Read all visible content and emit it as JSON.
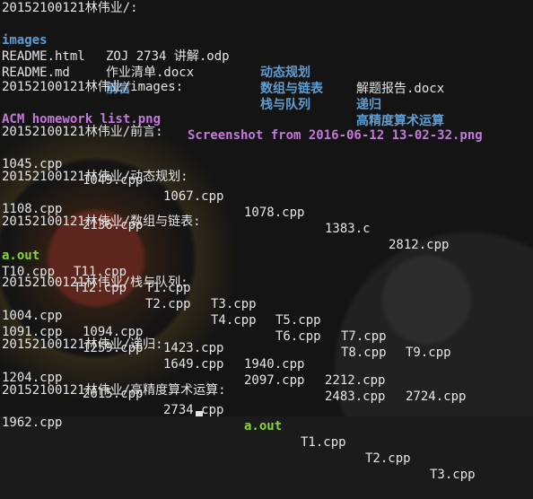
{
  "colors": {
    "background": "#1b1b1b",
    "text": "#e6e6e6",
    "directory": "#5f9ed5",
    "executable": "#87d72f",
    "image_file": "#c678dd"
  },
  "root_header": "20152100121林伟业/:",
  "root_listing": [
    {
      "name": "images",
      "type": "dir"
    },
    {
      "name": "ZOJ 2734 讲解.odp",
      "type": "file"
    },
    {
      "name": "动态规划",
      "type": "dir"
    },
    {
      "name": "解题报告.docx",
      "type": "file"
    },
    {
      "name": "README.html",
      "type": "file"
    },
    {
      "name": "作业清单.docx",
      "type": "file"
    },
    {
      "name": "数组与链表",
      "type": "dir"
    },
    {
      "name": "递归",
      "type": "dir"
    },
    {
      "name": "README.md",
      "type": "file"
    },
    {
      "name": "前言",
      "type": "dir"
    },
    {
      "name": "栈与队列",
      "type": "dir"
    },
    {
      "name": "高精度算术运算",
      "type": "dir"
    }
  ],
  "images_header": "20152100121林伟业/images:",
  "images_files": [
    "ACM homework list.png",
    "Screenshot from 2016-06-12 13-02-32.png"
  ],
  "qianyan_header": "20152100121林伟业/前言:",
  "qianyan_files": [
    "1045.cpp",
    "1049.cpp",
    "1067.cpp",
    "1078.cpp",
    "1383.c",
    "2812.cpp"
  ],
  "dp_header": "20152100121林伟业/动态规划:",
  "dp_files": [
    "1108.cpp",
    "2136.cpp"
  ],
  "arr_header": "20152100121林伟业/数组与链表:",
  "arr_files": [
    {
      "name": "a.out",
      "type": "exe"
    },
    {
      "name": "T11.cpp",
      "type": "file"
    },
    {
      "name": "T1.cpp",
      "type": "file"
    },
    {
      "name": "T3.cpp",
      "type": "file"
    },
    {
      "name": "T5.cpp",
      "type": "file"
    },
    {
      "name": "T7.cpp",
      "type": "file"
    },
    {
      "name": "T9.cpp",
      "type": "file"
    },
    {
      "name": "T10.cpp",
      "type": "file"
    },
    {
      "name": "T12.cpp",
      "type": "file"
    },
    {
      "name": "T2.cpp",
      "type": "file"
    },
    {
      "name": "T4.cpp",
      "type": "file"
    },
    {
      "name": "T6.cpp",
      "type": "file"
    },
    {
      "name": "T8.cpp",
      "type": "file"
    }
  ],
  "stack_header": "20152100121林伟业/栈与队列:",
  "stack_files": [
    "1004.cpp",
    "1094.cpp",
    "1423.cpp",
    "1940.cpp",
    "2212.cpp",
    "2724.cpp",
    "1091.cpp",
    "1259.cpp",
    "1649.cpp",
    "2097.cpp",
    "2483.cpp"
  ],
  "rec_header": "20152100121林伟业/递归:",
  "rec_files": [
    {
      "name": "1204.cpp",
      "type": "file"
    },
    {
      "name": "2615.cpp",
      "type": "file"
    },
    {
      "name": "2734.cpp",
      "type": "file"
    },
    {
      "name": "a.out",
      "type": "exe"
    },
    {
      "name": "T1.cpp",
      "type": "file"
    },
    {
      "name": "T2.cpp",
      "type": "file"
    },
    {
      "name": "T3.cpp",
      "type": "file"
    }
  ],
  "hp_header": "20152100121林伟业/高精度算术运算:",
  "hp_files": [
    "1962.cpp"
  ]
}
